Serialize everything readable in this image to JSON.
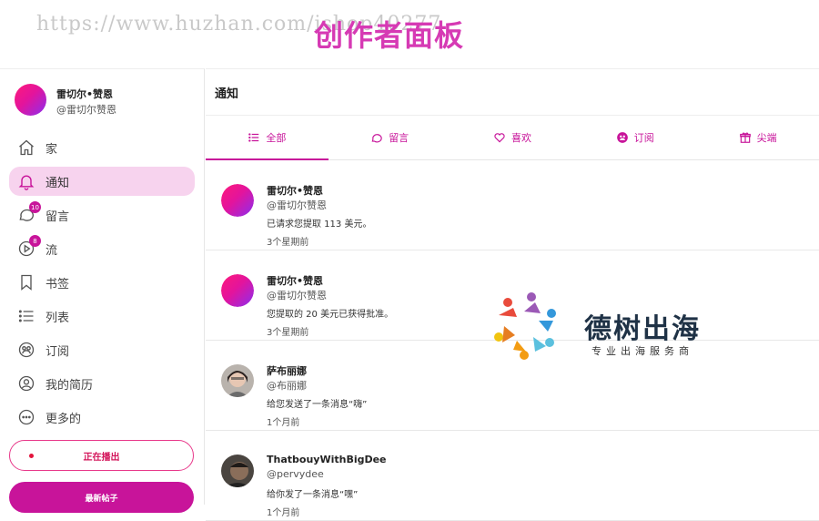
{
  "banner": {
    "watermark": "https://www.huzhan.com/ishop40277",
    "title": "创作者面板"
  },
  "profile": {
    "name": "雷切尔•赞恩",
    "handle": "@雷切尔赞恩"
  },
  "nav": {
    "items": [
      {
        "label": "家",
        "icon": "home-icon"
      },
      {
        "label": "通知",
        "icon": "bell-icon",
        "active": true
      },
      {
        "label": "留言",
        "icon": "chat-icon",
        "badge": "10"
      },
      {
        "label": "流",
        "icon": "play-icon",
        "badge": "8"
      },
      {
        "label": "书签",
        "icon": "bookmark-icon"
      },
      {
        "label": "列表",
        "icon": "list-icon"
      },
      {
        "label": "订阅",
        "icon": "subscription-icon"
      },
      {
        "label": "我的简历",
        "icon": "user-circle-icon"
      },
      {
        "label": "更多的",
        "icon": "more-icon"
      }
    ]
  },
  "buttons": {
    "live": "正在播出",
    "new_post": "最新帖子"
  },
  "main": {
    "title": "通知",
    "tabs": [
      {
        "label": "全部",
        "icon": "list-icon",
        "active": true
      },
      {
        "label": "留言",
        "icon": "comment-icon"
      },
      {
        "label": "喜欢",
        "icon": "heart-icon"
      },
      {
        "label": "订阅",
        "icon": "subscription-icon"
      },
      {
        "label": "尖端",
        "icon": "gift-icon"
      }
    ],
    "notifications": [
      {
        "name": "雷切尔•赞恩",
        "handle": "@雷切尔赞恩",
        "text": "已请求您提取 113 美元。",
        "time": "3个星期前",
        "avatar": "gradient"
      },
      {
        "name": "雷切尔•赞恩",
        "handle": "@雷切尔赞恩",
        "text": "您提取的 20 美元已获得批准。",
        "time": "3个星期前",
        "avatar": "gradient"
      },
      {
        "name": "萨布丽娜",
        "handle": "@布丽娜",
        "text": "给您发送了一条消息“嗨”",
        "time": "1个月前",
        "avatar": "photo-woman"
      },
      {
        "name": "ThatbouyWithBigDee",
        "handle": "@pervydee",
        "text": "给你发了一条消息“嘿”",
        "time": "1个月前",
        "avatar": "photo-man"
      }
    ]
  },
  "overlay_logo": {
    "title": "德树出海",
    "subtitle": "专业出海服务商"
  },
  "colors": {
    "accent": "#c8149a",
    "active_bg": "#f7d3ee",
    "banner_title": "#d63ab4"
  }
}
